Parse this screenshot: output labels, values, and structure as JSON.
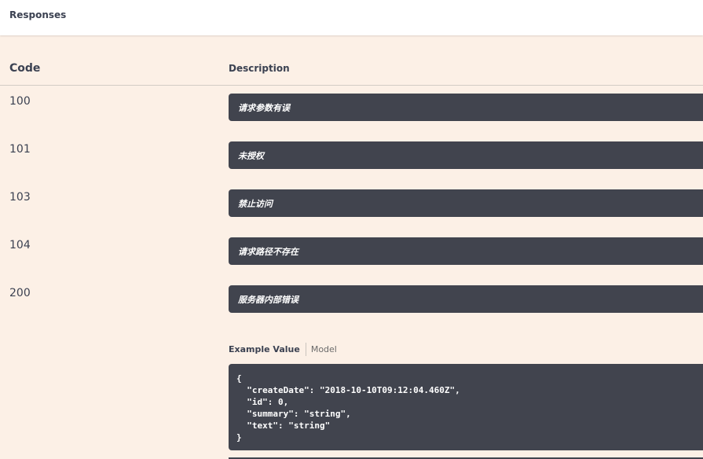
{
  "section": {
    "title": "Responses"
  },
  "table": {
    "headers": {
      "code": "Code",
      "description": "Description"
    },
    "rows": [
      {
        "code": "100",
        "description": "请求参数有误"
      },
      {
        "code": "101",
        "description": "未授权"
      },
      {
        "code": "103",
        "description": "禁止访问"
      },
      {
        "code": "104",
        "description": "请求路径不存在"
      },
      {
        "code": "200",
        "description": "服务器内部错误"
      }
    ]
  },
  "example": {
    "tabs": {
      "example_value": "Example Value",
      "model": "Model"
    },
    "json": "{\n  \"createDate\": \"2018-10-10T09:12:04.460Z\",\n  \"id\": 0,\n  \"summary\": \"string\",\n  \"text\": \"string\"\n}"
  },
  "colors": {
    "page_background": "#fcf0e6",
    "dark_box": "#41444e",
    "text": "#3b4151"
  }
}
